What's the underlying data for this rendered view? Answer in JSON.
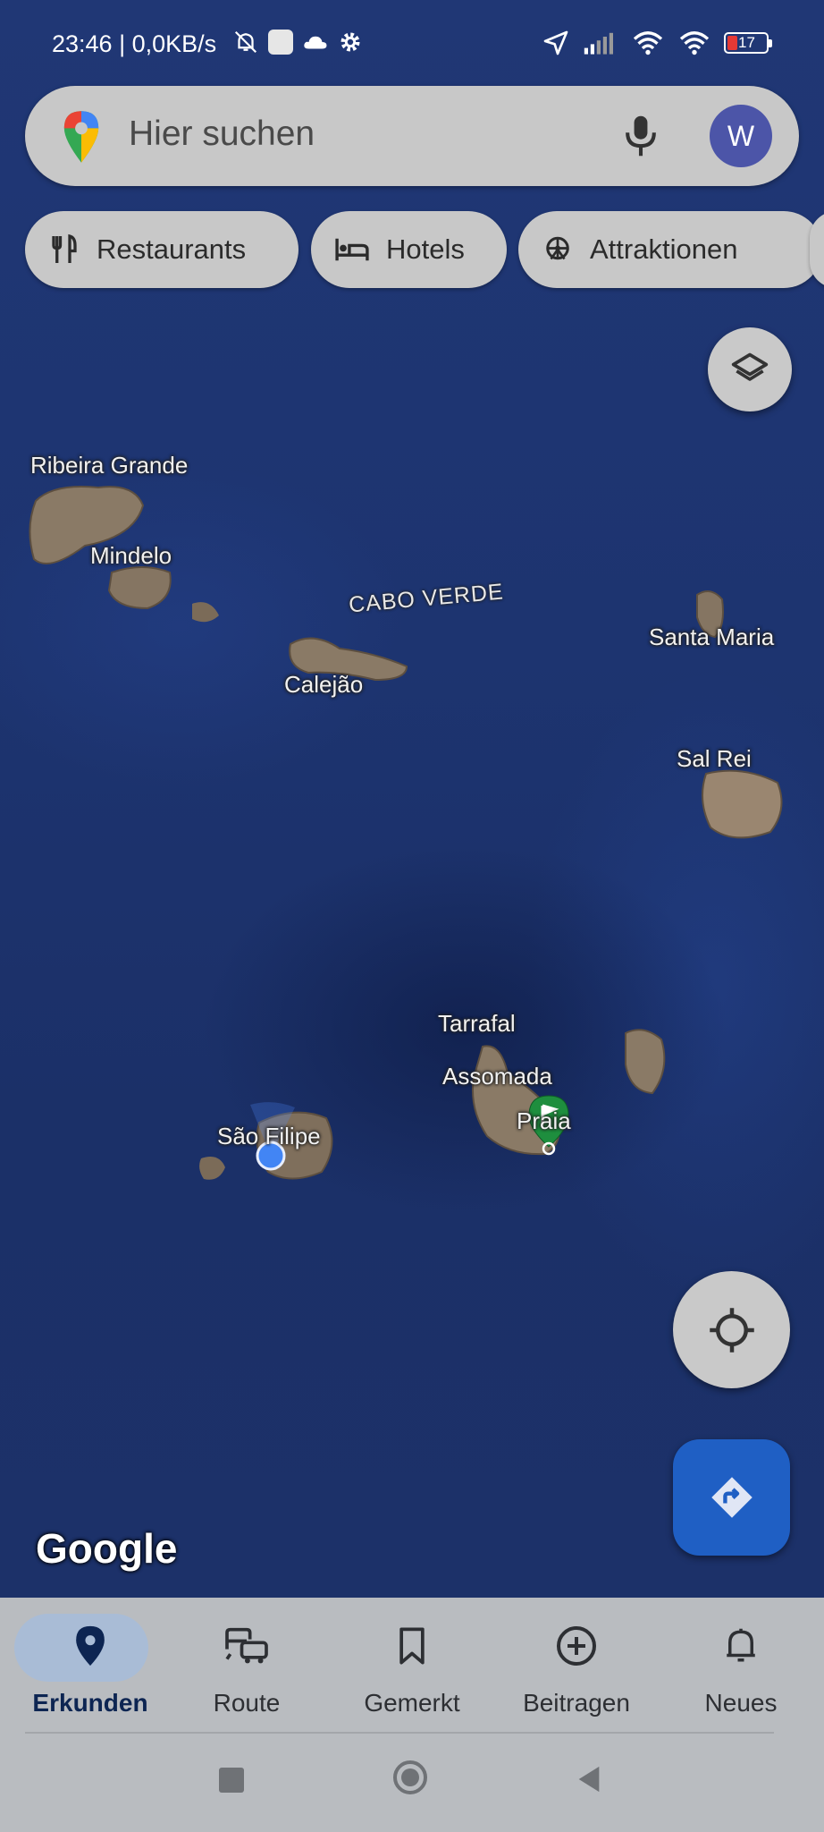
{
  "status_bar": {
    "time": "23:46",
    "network_speed": "| 0,0KB/s",
    "battery": "17",
    "icons": [
      "bell-off-icon",
      "app-icon",
      "cloud-icon",
      "gear-icon",
      "location-icon",
      "signal-icon",
      "wifi-icon",
      "wifi-calling-icon",
      "battery-icon"
    ]
  },
  "search": {
    "placeholder": "Hier suchen",
    "avatar_letter": "W"
  },
  "chips": [
    {
      "label": "Restaurants",
      "icon": "restaurant-icon"
    },
    {
      "label": "Hotels",
      "icon": "hotel-icon"
    },
    {
      "label": "Attraktionen",
      "icon": "attraction-icon"
    }
  ],
  "map": {
    "country": "CABO VERDE",
    "places": [
      "Ribeira Grande",
      "Mindelo",
      "Calejão",
      "Santa Maria",
      "Sal Rei",
      "Tarrafal",
      "Assomada",
      "Praia",
      "São Filipe"
    ],
    "attribution": "Google",
    "colors": {
      "ocean": "#1e3570",
      "land": "#8a7a66",
      "location_dot": "#4285f4",
      "pin": "#1e8e3e"
    }
  },
  "bottom_nav": {
    "tabs": [
      {
        "label": "Erkunden",
        "icon": "explore-pin-icon",
        "active": true
      },
      {
        "label": "Route",
        "icon": "commute-icon",
        "active": false
      },
      {
        "label": "Gemerkt",
        "icon": "bookmark-icon",
        "active": false
      },
      {
        "label": "Beitragen",
        "icon": "add-circle-icon",
        "active": false
      },
      {
        "label": "Neues",
        "icon": "bell-icon",
        "active": false
      }
    ]
  }
}
